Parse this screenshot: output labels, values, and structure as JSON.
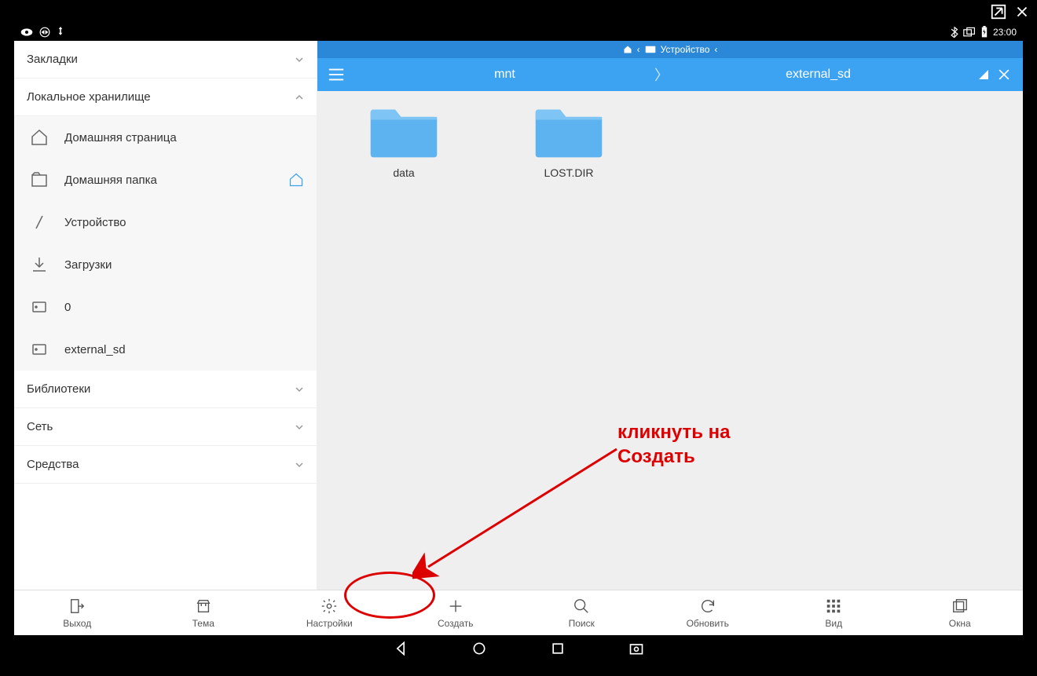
{
  "status": {
    "time": "23:00"
  },
  "sidebar": {
    "sections": {
      "bookmarks": "Закладки",
      "local_storage": "Локальное хранилище",
      "libraries": "Библиотеки",
      "network": "Сеть",
      "tools": "Средства"
    },
    "items": {
      "home_page": "Домашняя страница",
      "home_folder": "Домашняя папка",
      "device": "Устройство",
      "downloads": "Загрузки",
      "zero": "0",
      "external_sd": "external_sd"
    }
  },
  "breadcrumb": {
    "device_label": "Устройство"
  },
  "path": {
    "seg1": "mnt",
    "seg2": "external_sd"
  },
  "folders": {
    "f1": "data",
    "f2": "LOST.DIR"
  },
  "toolbar": {
    "exit": "Выход",
    "theme": "Тема",
    "settings": "Настройки",
    "create": "Создать",
    "search": "Поиск",
    "refresh": "Обновить",
    "view": "Вид",
    "windows": "Окна"
  },
  "annotation": {
    "line1": "кликнуть на",
    "line2": "Создать"
  }
}
